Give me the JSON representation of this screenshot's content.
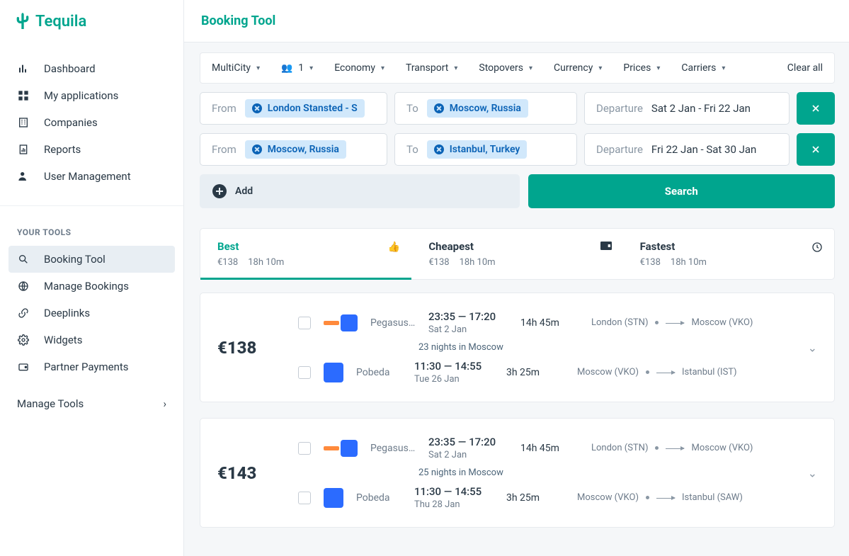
{
  "brand": {
    "name": "Tequila"
  },
  "header": {
    "title": "Booking Tool"
  },
  "sidebar": {
    "main": [
      {
        "label": "Dashboard"
      },
      {
        "label": "My applications"
      },
      {
        "label": "Companies"
      },
      {
        "label": "Reports"
      },
      {
        "label": "User Management"
      }
    ],
    "tools_title": "YOUR TOOLS",
    "tools": [
      {
        "label": "Booking Tool"
      },
      {
        "label": "Manage Bookings"
      },
      {
        "label": "Deeplinks"
      },
      {
        "label": "Widgets"
      },
      {
        "label": "Partner Payments"
      }
    ],
    "manage_tools": "Manage Tools"
  },
  "filters": {
    "trip_type": "MultiCity",
    "passengers": "1",
    "cabin": "Economy",
    "transport": "Transport",
    "stopovers": "Stopovers",
    "currency": "Currency",
    "prices": "Prices",
    "carriers": "Carriers",
    "clear_all": "Clear all"
  },
  "search": {
    "rows": [
      {
        "from_label": "From",
        "from_value": "London Stansted - S",
        "to_label": "To",
        "to_value": "Moscow, Russia",
        "departure_label": "Departure",
        "departure_value": "Sat 2 Jan - Fri 22 Jan"
      },
      {
        "from_label": "From",
        "from_value": "Moscow, Russia",
        "to_label": "To",
        "to_value": "Istanbul, Turkey",
        "departure_label": "Departure",
        "departure_value": "Fri 22 Jan - Sat 30 Jan"
      }
    ],
    "add_label": "Add",
    "search_label": "Search"
  },
  "sort_tabs": [
    {
      "title": "Best",
      "price": "€138",
      "duration": "18h 10m"
    },
    {
      "title": "Cheapest",
      "price": "€138",
      "duration": "18h 10m"
    },
    {
      "title": "Fastest",
      "price": "€138",
      "duration": "18h 10m"
    }
  ],
  "results": [
    {
      "price": "€138",
      "seg1": {
        "airlines": "Pegasus, …",
        "time_line": "23:35 — 17:20",
        "date_line": "Sat 2 Jan",
        "duration": "14h 45m",
        "from": "London (STN)",
        "to": "Moscow (VKO)"
      },
      "nights": "23 nights in Moscow",
      "seg2": {
        "airlines": "Pobeda",
        "time_line": "11:30 — 14:55",
        "date_line": "Tue 26 Jan",
        "duration": "3h 25m",
        "from": "Moscow (VKO)",
        "to": "Istanbul (IST)"
      }
    },
    {
      "price": "€143",
      "seg1": {
        "airlines": "Pegasus, …",
        "time_line": "23:35 — 17:20",
        "date_line": "Sat 2 Jan",
        "duration": "14h 45m",
        "from": "London (STN)",
        "to": "Moscow (VKO)"
      },
      "nights": "25 nights in Moscow",
      "seg2": {
        "airlines": "Pobeda",
        "time_line": "11:30 — 14:55",
        "date_line": "Thu 28 Jan",
        "duration": "3h 25m",
        "from": "Moscow (VKO)",
        "to": "Istanbul (SAW)"
      }
    }
  ]
}
